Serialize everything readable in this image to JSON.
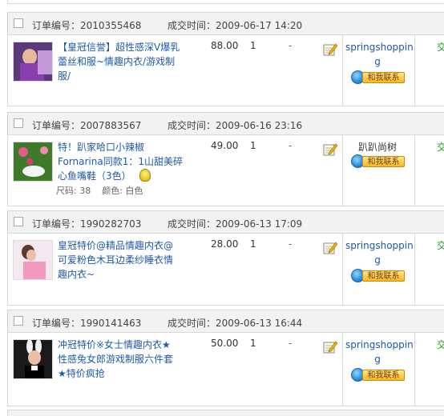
{
  "labels": {
    "order_no_prefix": "订单编号：",
    "deal_time_prefix": "成交时间：",
    "spec_size_prefix": "尺码: ",
    "spec_color_prefix": "颜色: ",
    "contact_me": "和我联系"
  },
  "orders": [
    {
      "order_no": "2010355468",
      "deal_time": "2009-06-17 14:20",
      "title_line1": "【皇冠信誉】超性感深V爆乳",
      "title_line2": "蕾丝和服~情趣内衣/游戏制",
      "title_line3": "服/",
      "price": "88.00",
      "qty": "1",
      "dash": "-",
      "seller_line1": "springshoppin",
      "seller_line2": "g",
      "cut_char": "交"
    },
    {
      "order_no": "2007883567",
      "deal_time": "2009-06-16 23:16",
      "title_line1": "特！趴家哈口小辣椒",
      "title_line2": "Fornarina同款1：1山甜美碎",
      "title_line3": "心鱼嘴鞋（3色）",
      "spec_size": "38",
      "spec_color": "白色",
      "price": "49.00",
      "qty": "1",
      "dash": "-",
      "seller_line1": "趴趴尚树",
      "seller_line2": "",
      "cut_char": "交"
    },
    {
      "order_no": "1990282703",
      "deal_time": "2009-06-13 17:09",
      "title_line1": "皇冠特价@精品情趣内衣@",
      "title_line2": "可爱粉色木耳边柔纱睡衣情",
      "title_line3": "趣内衣~",
      "price": "28.00",
      "qty": "1",
      "dash": "-",
      "seller_line1": "springshoppin",
      "seller_line2": "g",
      "cut_char": "交"
    },
    {
      "order_no": "1990141463",
      "deal_time": "2009-06-13 16:44",
      "title_line1": "冲冠特价※女士情趣内衣★",
      "title_line2": "性感兔女郎游戏制服六件套",
      "title_line3": "★特价疯抢",
      "price": "50.00",
      "qty": "1",
      "dash": "-",
      "seller_line1": "springshoppin",
      "seller_line2": "g",
      "cut_char": "交"
    }
  ],
  "colors": {
    "link_blue": "#1f58a8",
    "header_bg": "#f2f2f2",
    "border": "#d8d8d8",
    "status_green": "#1f9a1f"
  },
  "icons": {
    "memo": "memo-pencil-icon",
    "wangwang": "wangwang-icon"
  }
}
